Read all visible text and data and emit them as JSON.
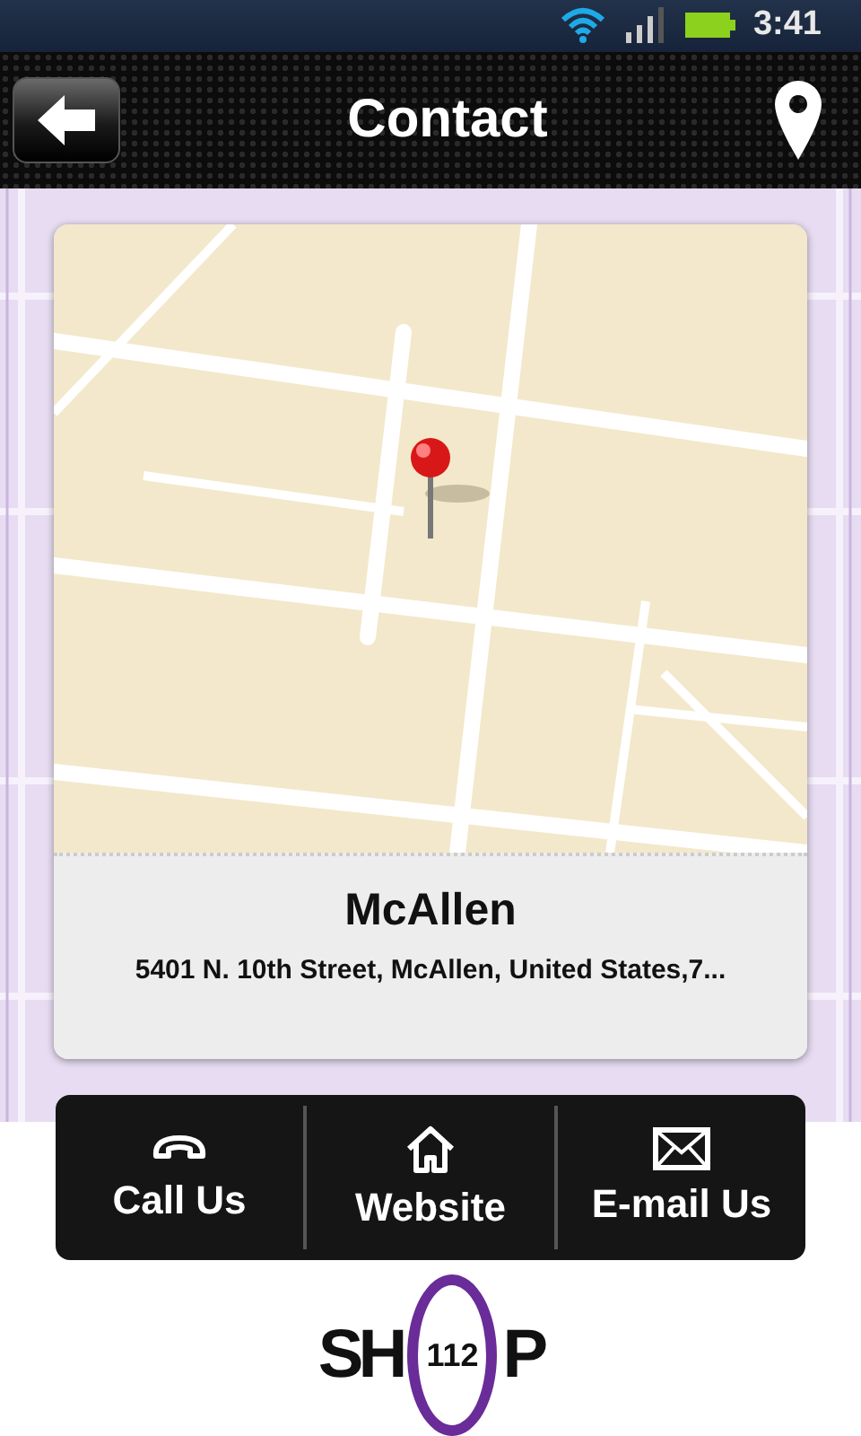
{
  "status_bar": {
    "time": "3:41"
  },
  "header": {
    "title": "Contact"
  },
  "location": {
    "kind": "picture",
    "name": "McAllen",
    "address": "5401 N. 10th Street, McAllen, United States,7..."
  },
  "actions": [
    {
      "kind": "phone",
      "label": "Call Us"
    },
    {
      "kind": "home",
      "label": "Website"
    },
    {
      "kind": "mail",
      "label": "E-mail Us"
    }
  ],
  "logo": {
    "left": "SH",
    "middle": "112",
    "right": "P"
  }
}
